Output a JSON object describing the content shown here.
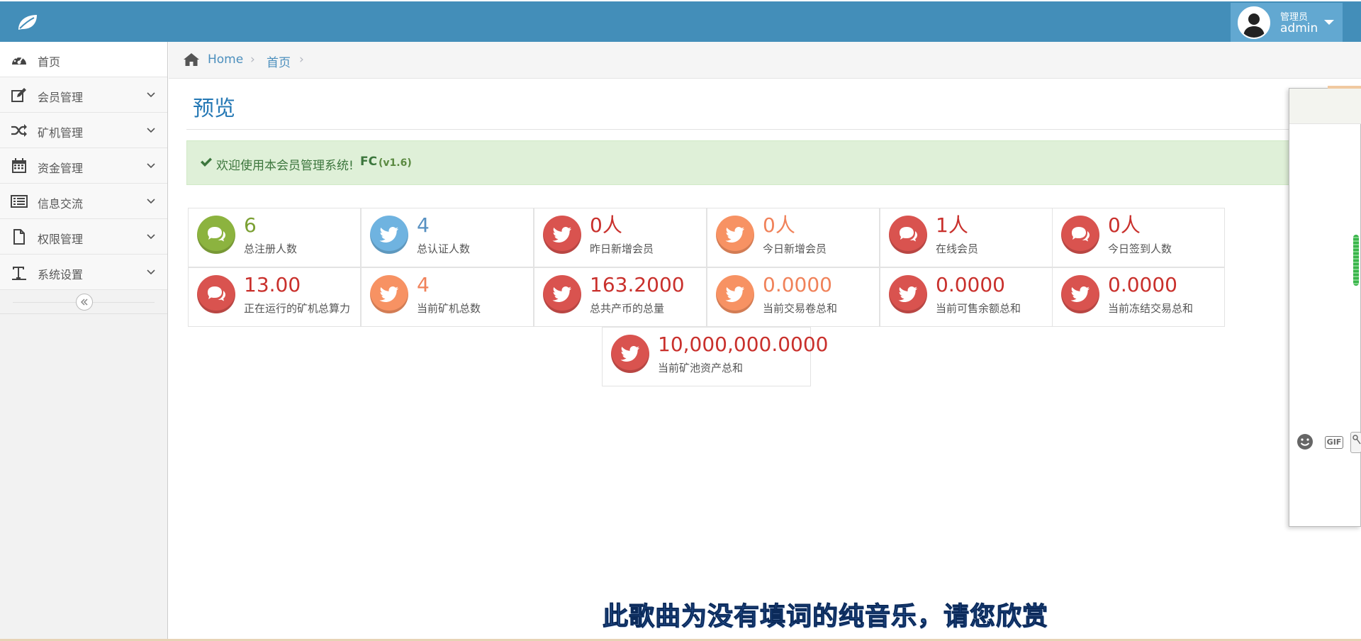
{
  "header": {
    "user_role": "管理员",
    "user_name": "admin",
    "brand_icon": "leaf-icon",
    "bar_color": "#438eb9"
  },
  "sidebar": {
    "items": [
      {
        "label": "首页",
        "icon": "dashboard-icon"
      },
      {
        "label": "会员管理",
        "icon": "edit-icon"
      },
      {
        "label": "矿机管理",
        "icon": "random-icon"
      },
      {
        "label": "资金管理",
        "icon": "calendar-icon"
      },
      {
        "label": "信息交流",
        "icon": "list-icon"
      },
      {
        "label": "权限管理",
        "icon": "file-icon"
      },
      {
        "label": "系统设置",
        "icon": "text-icon"
      }
    ]
  },
  "breadcrumb": {
    "home": "Home",
    "current": "首页",
    "separator": "›"
  },
  "page": {
    "title": "预览"
  },
  "alert": {
    "text": "欢迎使用本会员管理系统!",
    "brand": "FC",
    "version": "(v1.6)"
  },
  "stats": [
    {
      "value": "6",
      "label": "总注册人数",
      "color": "green",
      "icon": "comments-icon"
    },
    {
      "value": "4",
      "label": "总认证人数",
      "color": "blue",
      "icon": "twitter-icon"
    },
    {
      "value": "0人",
      "label": "昨日新增会员",
      "color": "red",
      "icon": "twitter-icon"
    },
    {
      "value": "0人",
      "label": "今日新增会员",
      "color": "orange",
      "icon": "twitter-icon"
    },
    {
      "value": "1人",
      "label": "在线会员",
      "color": "red",
      "icon": "comments-icon"
    },
    {
      "value": "0人",
      "label": "今日签到人数",
      "color": "red",
      "icon": "comments-icon"
    },
    {
      "value": "13.00",
      "label": "正在运行的矿机总算力",
      "color": "red",
      "icon": "comments-icon"
    },
    {
      "value": "4",
      "label": "当前矿机总数",
      "color": "orange",
      "icon": "twitter-icon"
    },
    {
      "value": "163.2000",
      "label": "总共产币的总量",
      "color": "red",
      "icon": "twitter-icon"
    },
    {
      "value": "0.0000",
      "label": "当前交易卷总和",
      "color": "orange",
      "icon": "twitter-icon"
    },
    {
      "value": "0.0000",
      "label": "当前可售余额总和",
      "color": "red",
      "icon": "twitter-icon"
    },
    {
      "value": "0.0000",
      "label": "当前冻结交易总和",
      "color": "red",
      "icon": "twitter-icon"
    },
    {
      "value": "10,000,000.0000",
      "label": "当前矿池资产总和",
      "color": "red",
      "icon": "twitter-icon"
    }
  ],
  "chat": {
    "gif_label": "GIF"
  },
  "subtitle": "此歌曲为没有填词的纯音乐，请您欣赏"
}
